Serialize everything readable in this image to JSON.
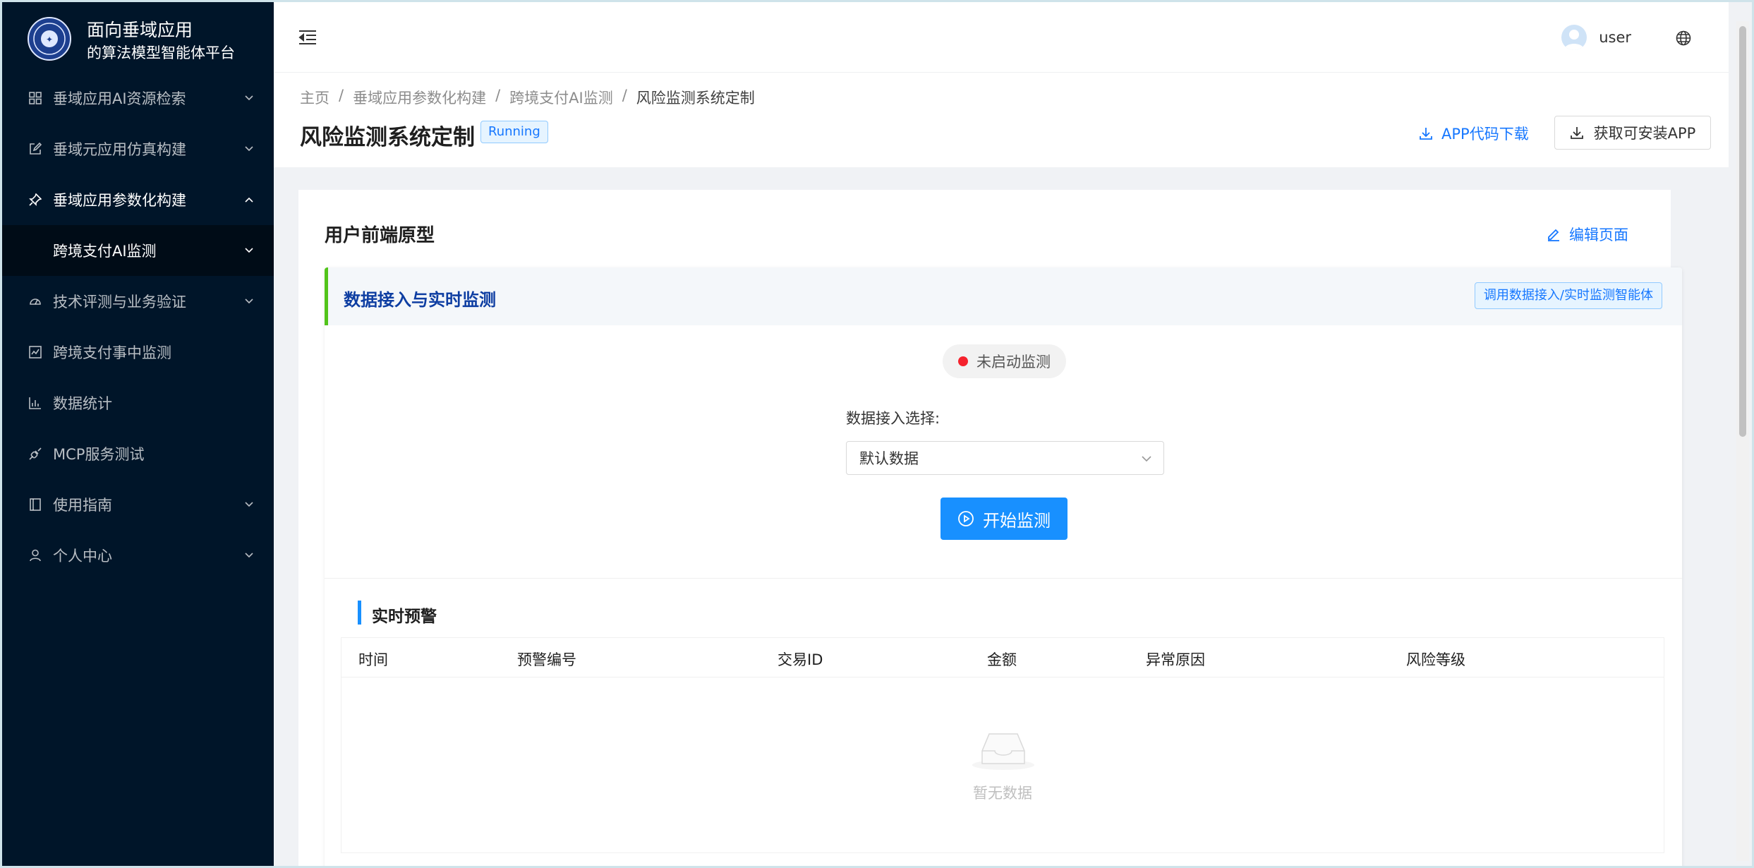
{
  "brand": {
    "line1": "面向垂域应用",
    "line2": "的算法模型智能体平台",
    "logo_icon": "university-seal-icon"
  },
  "sidebar": {
    "items": [
      {
        "label": "垂域应用AI资源检索",
        "icon": "appstore-icon",
        "arrow": "down"
      },
      {
        "label": "垂域元应用仿真构建",
        "icon": "form-edit-icon",
        "arrow": "down"
      },
      {
        "label": "垂域应用参数化构建",
        "icon": "pushpin-icon",
        "arrow": "up"
      },
      {
        "label": "跨境支付AI监测",
        "icon": "",
        "arrow": "down"
      },
      {
        "label": "技术评测与业务验证",
        "icon": "dashboard-icon",
        "arrow": "down"
      },
      {
        "label": "跨境支付事中监测",
        "icon": "line-chart-icon",
        "arrow": ""
      },
      {
        "label": "数据统计",
        "icon": "bar-chart-icon",
        "arrow": ""
      },
      {
        "label": "MCP服务测试",
        "icon": "api-icon",
        "arrow": ""
      },
      {
        "label": "使用指南",
        "icon": "book-icon",
        "arrow": "down"
      },
      {
        "label": "个人中心",
        "icon": "user-icon",
        "arrow": "down"
      }
    ]
  },
  "header": {
    "user_name": "user"
  },
  "breadcrumb": {
    "items": [
      "主页",
      "垂域应用参数化构建",
      "跨境支付AI监测",
      "风险监测系统定制"
    ],
    "separator": "/"
  },
  "page": {
    "title": "风险监测系统定制",
    "status": "Running",
    "code_download": "APP代码下载",
    "get_app": "获取可安装APP"
  },
  "card": {
    "title": "用户前端原型",
    "edit_link": "编辑页面"
  },
  "section": {
    "title": "数据接入与实时监测",
    "agent_tag": "调用数据接入/实时监测智能体",
    "monitor_status": "未启动监测",
    "select_label": "数据接入选择:",
    "select_value": "默认数据",
    "start_button": "开始监测"
  },
  "alerts": {
    "title": "实时预警",
    "columns": [
      "时间",
      "预警编号",
      "交易ID",
      "金额",
      "异常原因",
      "风险等级"
    ],
    "rows": [],
    "empty_text": "暂无数据"
  },
  "colors": {
    "sidebar_bg": "#001529",
    "sidebar_sub_bg": "#000c17",
    "primary": "#1890ff",
    "link": "#1677ff",
    "status_dot": "#f5222d",
    "section_accent": "#52c41a",
    "section_title": "#0e3ea2"
  }
}
